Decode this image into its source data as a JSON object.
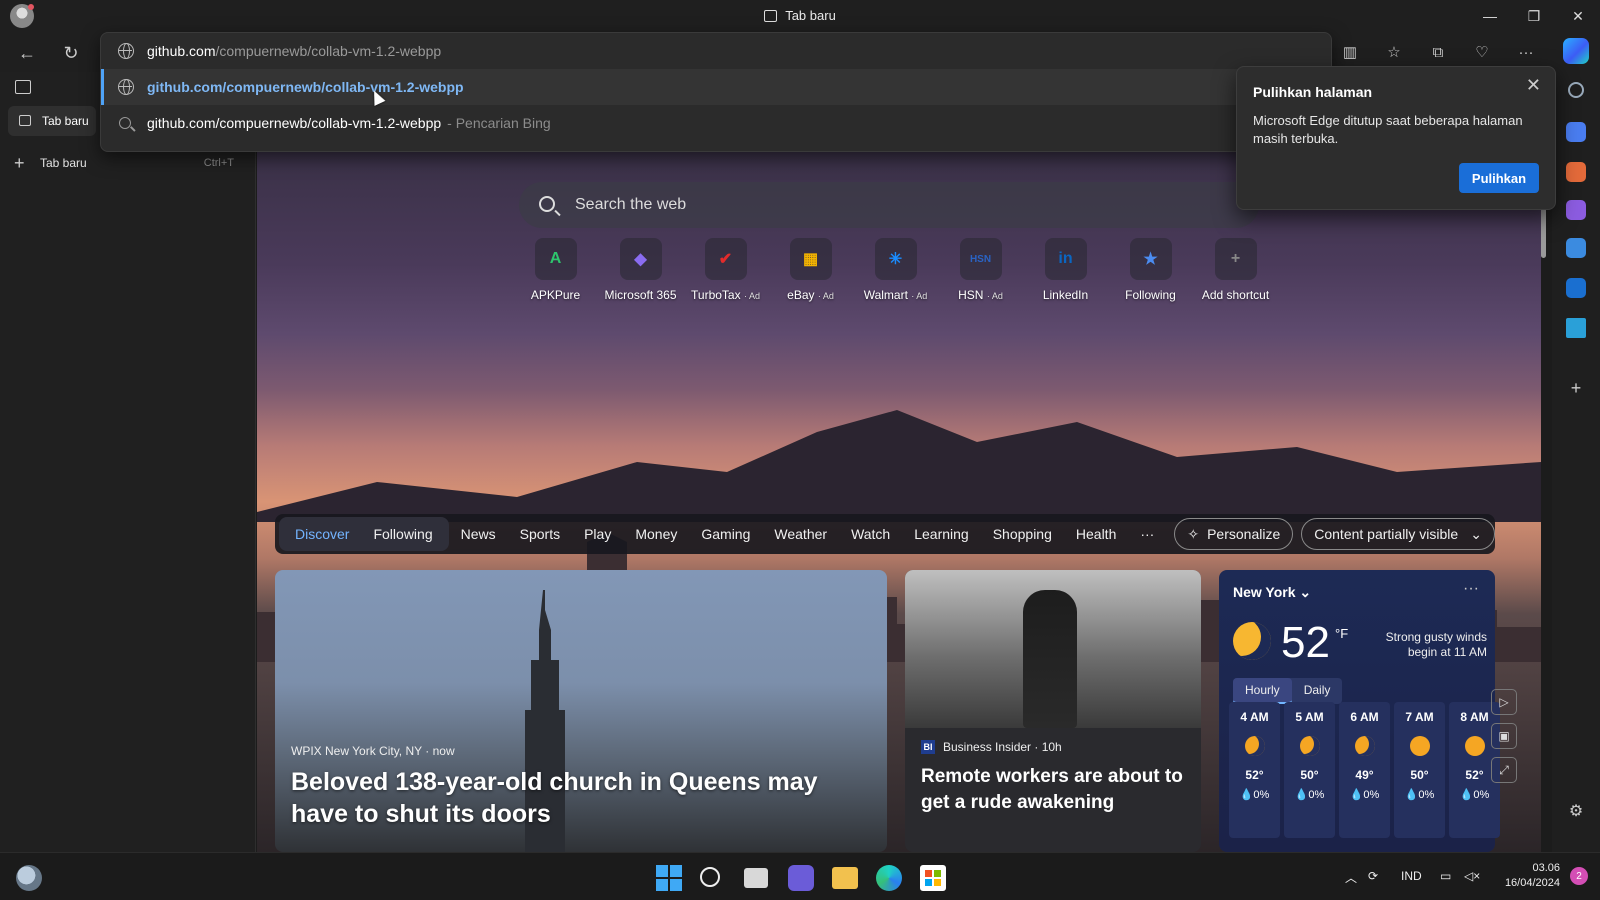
{
  "window": {
    "title": "Tab baru"
  },
  "address_bar": {
    "url_host": "github.com",
    "url_path": "/compuernewb/collab-vm-1.2-webpp"
  },
  "suggestions": [
    {
      "text": "github.com/compuernewb/collab-vm-1.2-webpp",
      "suffix": ""
    },
    {
      "text": "github.com/compuernewb/collab-vm-1.2-webpp",
      "suffix": "- Pencarian Bing"
    }
  ],
  "vertical_tabs": {
    "active_tab": "Tab baru",
    "new_tab_label": "Tab baru",
    "new_tab_shortcut": "Ctrl+T"
  },
  "new_tab_page": {
    "search_placeholder": "Search the web",
    "shortcuts": [
      {
        "label": "APKPure",
        "ad": "",
        "icon": "apkpure-icon",
        "glyph": "A",
        "color": "#2ec46d"
      },
      {
        "label": "Microsoft 365",
        "ad": "",
        "icon": "microsoft-365-icon",
        "glyph": "◆",
        "color": "#8a6cf0"
      },
      {
        "label": "TurboTax",
        "ad": "· Ad",
        "icon": "turbotax-icon",
        "glyph": "✔",
        "color": "#e32b2b"
      },
      {
        "label": "eBay",
        "ad": "· Ad",
        "icon": "ebay-icon",
        "glyph": "▦",
        "color": "#f4b400"
      },
      {
        "label": "Walmart",
        "ad": "· Ad",
        "icon": "walmart-icon",
        "glyph": "✳",
        "color": "#1a8cff"
      },
      {
        "label": "HSN",
        "ad": "· Ad",
        "icon": "hsn-icon",
        "glyph": "HSN",
        "color": "#2a63c4"
      },
      {
        "label": "LinkedIn",
        "ad": "",
        "icon": "linkedin-icon",
        "glyph": "in",
        "color": "#0a66c2"
      },
      {
        "label": "Following",
        "ad": "",
        "icon": "following-icon",
        "glyph": "★",
        "color": "#4b8cf0"
      },
      {
        "label": "Add shortcut",
        "ad": "",
        "icon": "add-shortcut-icon",
        "glyph": "+",
        "color": "#888888"
      }
    ],
    "feed_tabs": [
      "Discover",
      "Following",
      "News",
      "Sports",
      "Play",
      "Money",
      "Gaming",
      "Weather",
      "Watch",
      "Learning",
      "Shopping",
      "Health"
    ],
    "more": "···",
    "personalize": "Personalize",
    "visibility": "Content partially visible"
  },
  "cards": {
    "main": {
      "source": "WPIX New York City, NY · now",
      "headline": "Beloved 138-year-old church in Queens may have to shut its doors"
    },
    "second": {
      "source_logo": "BI",
      "source": "Business Insider · 10h",
      "headline": "Remote workers are about to get a rude awakening"
    }
  },
  "weather": {
    "city": "New York",
    "temp": "52",
    "unit": "°F",
    "note": "Strong gusty winds begin at 11 AM",
    "tabs": [
      "Hourly",
      "Daily"
    ],
    "hours": [
      {
        "time": "4 AM",
        "temp": "52°",
        "precip": "💧0%",
        "icon": "moon"
      },
      {
        "time": "5 AM",
        "temp": "50°",
        "precip": "💧0%",
        "icon": "moon"
      },
      {
        "time": "6 AM",
        "temp": "49°",
        "precip": "💧0%",
        "icon": "moon"
      },
      {
        "time": "7 AM",
        "temp": "50°",
        "precip": "💧0%",
        "icon": "sun"
      },
      {
        "time": "8 AM",
        "temp": "52°",
        "precip": "💧0%",
        "icon": "sun"
      }
    ]
  },
  "restore_popup": {
    "title": "Pulihkan halaman",
    "body": "Microsoft Edge ditutup saat beberapa halaman masih terbuka.",
    "button": "Pulihkan"
  },
  "taskbar": {
    "language": "IND",
    "time": "03.06",
    "date": "16/04/2024",
    "notifications": "2"
  }
}
